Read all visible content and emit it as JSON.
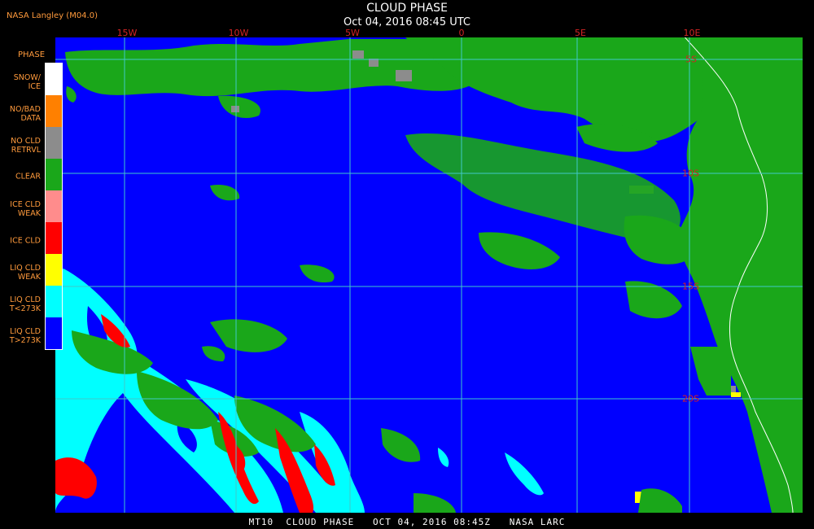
{
  "credit": "NASA Langley (M04.0)",
  "title": "CLOUD PHASE",
  "subtitle": "Oct 04, 2016 08:45 UTC",
  "footer": "MT10  CLOUD PHASE   OCT 04, 2016 08:45Z   NASA LARC",
  "legend": {
    "title": "PHASE",
    "items": [
      {
        "label": "SNOW/\nICE",
        "color": "#ffffff"
      },
      {
        "label": "NO/BAD\nDATA",
        "color": "#ff8000"
      },
      {
        "label": "NO CLD\nRETRVL",
        "color": "#8c8c8c"
      },
      {
        "label": "CLEAR",
        "color": "#1aa71a"
      },
      {
        "label": "ICE CLD\nWEAK",
        "color": "#ff8c8c"
      },
      {
        "label": "ICE CLD",
        "color": "#ff0000"
      },
      {
        "label": "LIQ CLD\nWEAK",
        "color": "#ffff00"
      },
      {
        "label": "LIQ CLD\nT<273K",
        "color": "#00ffff"
      },
      {
        "label": "LIQ CLD\nT>273K",
        "color": "#0000ff"
      }
    ]
  },
  "grid": {
    "longitudes": [
      "15W",
      "10W",
      "5W",
      "0",
      "5E",
      "10E"
    ],
    "latitudes": [
      "5S",
      "10S",
      "15S",
      "20S"
    ],
    "line_color": "#40c8c8",
    "label_color": "#d42424"
  },
  "colors": {
    "ocean_liquid": "#0000ff",
    "land_clear": "#1aa71a",
    "coast": "#ffffff"
  }
}
